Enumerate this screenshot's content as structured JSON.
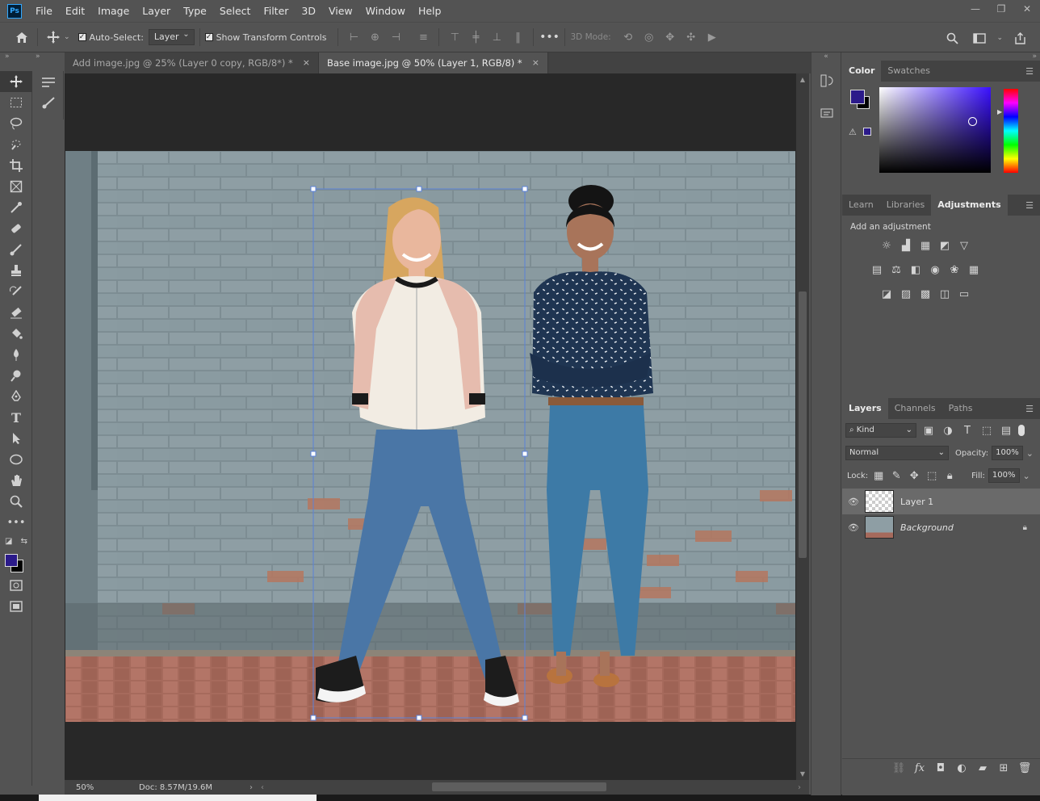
{
  "app": {
    "logo": "Ps"
  },
  "menu": [
    "File",
    "Edit",
    "Image",
    "Layer",
    "Type",
    "Select",
    "Filter",
    "3D",
    "View",
    "Window",
    "Help"
  ],
  "window_controls": {
    "minimize": "—",
    "restore": "❐",
    "close": "✕"
  },
  "options": {
    "auto_select_label": "Auto-Select:",
    "auto_select_value": "Layer",
    "transform_label": "Show Transform Controls",
    "mode_3d_label": "3D Mode:",
    "more": "•••"
  },
  "tabs": [
    {
      "title": "Add image.jpg @ 25% (Layer 0 copy, RGB/8*) *",
      "close": "×"
    },
    {
      "title": "Base image.jpg @ 50% (Layer 1, RGB/8) *",
      "close": "×"
    }
  ],
  "status": {
    "zoom": "50%",
    "doc": "Doc: 8.57M/19.6M"
  },
  "color_panel": {
    "tabs": [
      "Color",
      "Swatches"
    ],
    "foreground": "#2b1a8a",
    "background": "#000000"
  },
  "adjust_panel": {
    "tabs": [
      "Learn",
      "Libraries",
      "Adjustments"
    ],
    "hint": "Add an adjustment"
  },
  "layers_panel": {
    "tabs": [
      "Layers",
      "Channels",
      "Paths"
    ],
    "kind_label": "Kind",
    "blend_mode": "Normal",
    "opacity_label": "Opacity:",
    "opacity_value": "100%",
    "lock_label": "Lock:",
    "fill_label": "Fill:",
    "fill_value": "100%",
    "layers": [
      {
        "name": "Layer 1"
      },
      {
        "name": "Background"
      }
    ],
    "footer_fx": "fx"
  }
}
